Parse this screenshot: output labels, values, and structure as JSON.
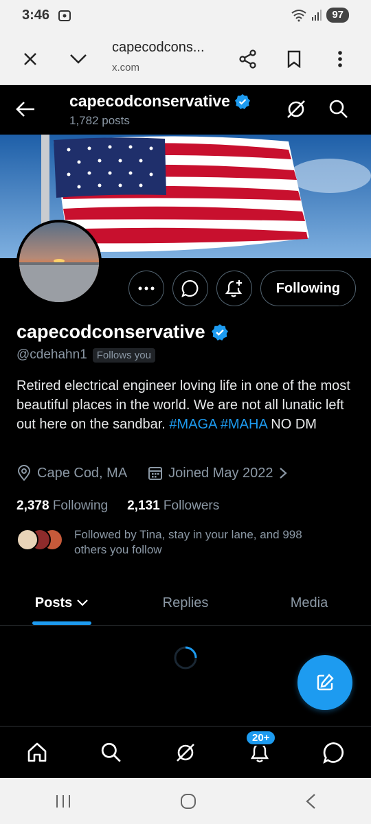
{
  "status_bar": {
    "time": "3:46",
    "battery": "97"
  },
  "browser": {
    "title": "capecodcons...",
    "domain": "x.com"
  },
  "header": {
    "name": "capecodconservative",
    "posts": "1,782 posts"
  },
  "profile": {
    "name": "capecodconservative",
    "handle": "@cdehahn1",
    "follows_you": "Follows you",
    "following_button": "Following",
    "bio_text_1": "Retired electrical engineer loving life in one of the most beautiful places in the world. We are not all lunatic left out here on the sandbar.",
    "bio_tag_1": "#MAGA",
    "bio_tag_2": "#MAHA",
    "bio_text_2": "NO DM",
    "location": "Cape Cod, MA",
    "joined": "Joined May 2022",
    "following_count": "2,378",
    "following_label": "Following",
    "followers_count": "2,131",
    "followers_label": "Followers",
    "followed_by": "Followed by Tina, stay in your lane, and 998 others you follow"
  },
  "tabs": [
    {
      "label": "Posts"
    },
    {
      "label": "Replies"
    },
    {
      "label": "Media"
    }
  ],
  "bottom_nav": {
    "notifications_badge": "20+"
  },
  "colors": {
    "accent": "#1d9bf0",
    "background": "#000000",
    "muted": "#8b98a5"
  },
  "icons": [
    "close-icon",
    "chevron-down-icon",
    "share-icon",
    "bookmark-icon",
    "more-vert-icon",
    "back-arrow-icon",
    "grok-icon",
    "search-icon",
    "verified-badge-icon",
    "more-horizontal-icon",
    "message-icon",
    "notification-add-icon",
    "location-icon",
    "calendar-icon",
    "chevron-right-icon",
    "compose-icon",
    "home-icon",
    "bell-icon",
    "recents-icon",
    "home-button-icon",
    "back-icon"
  ]
}
